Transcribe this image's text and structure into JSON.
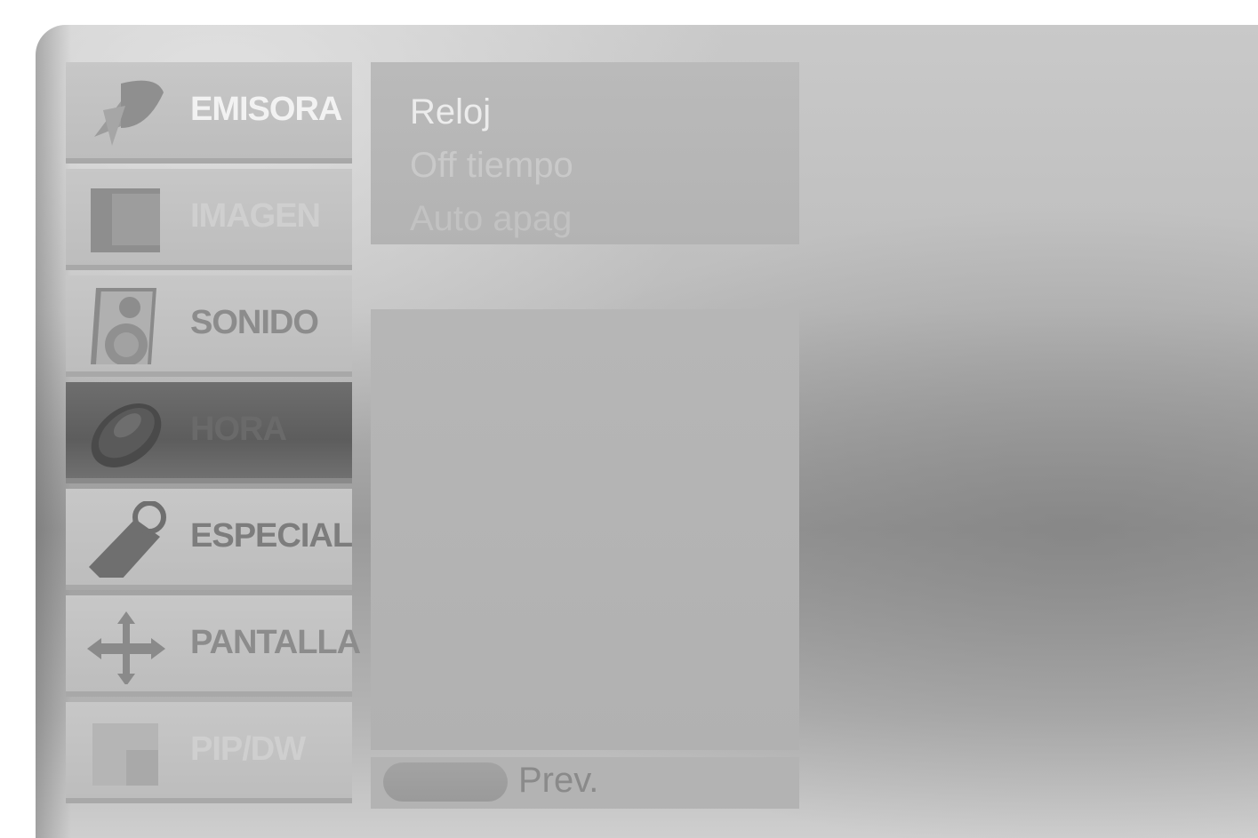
{
  "menu": {
    "items": [
      {
        "label": "EMISORA",
        "icon": "satellite-dish-icon"
      },
      {
        "label": "IMAGEN",
        "icon": "picture-icon"
      },
      {
        "label": "SONIDO",
        "icon": "speaker-icon"
      },
      {
        "label": "HORA",
        "icon": "clock-icon",
        "selected": true
      },
      {
        "label": "ESPECIAL",
        "icon": "tag-icon"
      },
      {
        "label": "PANTALLA",
        "icon": "move-arrows-icon"
      },
      {
        "label": "PIP/DW",
        "icon": "pip-icon"
      }
    ]
  },
  "submenu": {
    "options": [
      "Reloj",
      "Off tiempo",
      "Auto apag"
    ]
  },
  "footer": {
    "prev_label": "Prev."
  }
}
